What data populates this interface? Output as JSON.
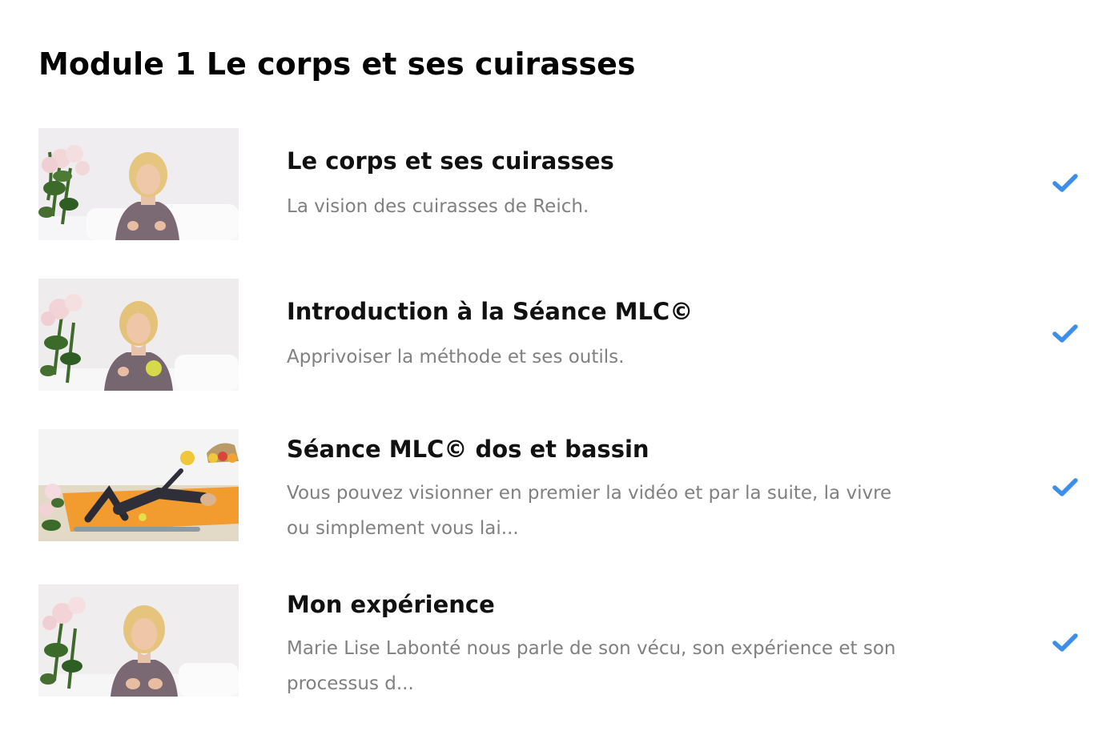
{
  "module": {
    "title": "Module 1 Le corps et ses cuirasses"
  },
  "accent_color": "#3d8ee8",
  "lessons": [
    {
      "title": "Le corps et ses cuirasses",
      "description": "La vision des cuirasses de Reich.",
      "completed": true,
      "status_icon": "checkmark-icon",
      "thumbnail_icon": "video-thumbnail"
    },
    {
      "title": "Introduction à la Séance MLC©",
      "description": "Apprivoiser la méthode et ses outils.",
      "completed": true,
      "status_icon": "checkmark-icon",
      "thumbnail_icon": "video-thumbnail"
    },
    {
      "title": "Séance MLC© dos et bassin",
      "description": "Vous pouvez visionner en premier la vidéo et par la suite, la vivre ou simplement vous lai...",
      "completed": true,
      "status_icon": "checkmark-icon",
      "thumbnail_icon": "video-thumbnail"
    },
    {
      "title": "Mon expérience",
      "description": "Marie Lise Labonté nous parle de son vécu, son expérience et son processus d...",
      "completed": true,
      "status_icon": "checkmark-icon",
      "thumbnail_icon": "video-thumbnail"
    }
  ]
}
